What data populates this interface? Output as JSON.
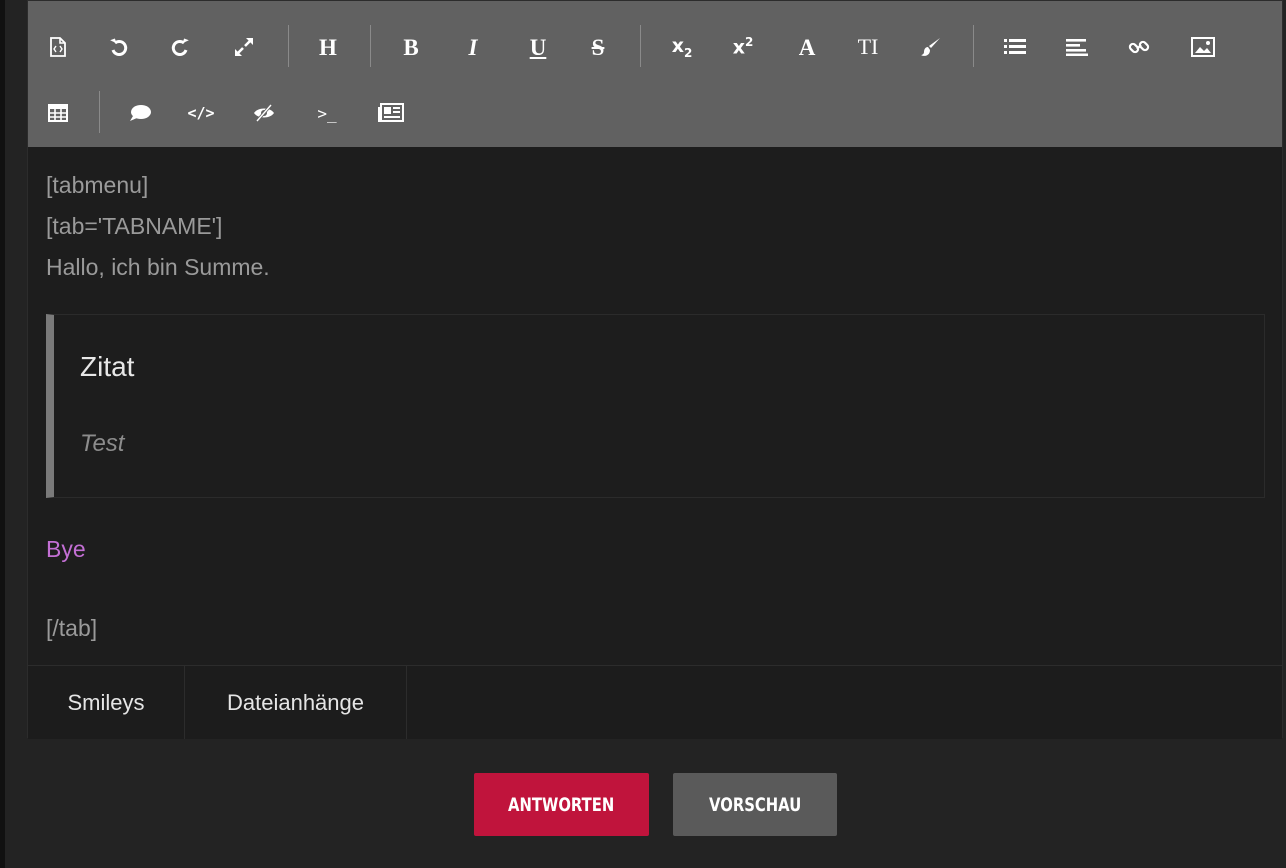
{
  "colors": {
    "toolbar_bg": "#616161",
    "editor_bg": "#1d1d1d",
    "text_gray": "#9a9a9a",
    "bye_text": "#c36fd4",
    "reply_button": "#c0143c",
    "preview_button": "#5a5a5a"
  },
  "toolbar": {
    "row1": [
      {
        "icon": "source-code-icon"
      },
      {
        "icon": "undo-icon"
      },
      {
        "icon": "redo-icon"
      },
      {
        "icon": "fullscreen-icon"
      },
      {
        "icon": "heading-icon",
        "label": "H"
      },
      {
        "icon": "bold-icon",
        "label": "B"
      },
      {
        "icon": "italic-icon",
        "label": "I"
      },
      {
        "icon": "underline-icon",
        "label": "U"
      },
      {
        "icon": "strikethrough-icon",
        "label": "S"
      },
      {
        "icon": "subscript-icon",
        "label": "x",
        "sub": "2"
      },
      {
        "icon": "superscript-icon",
        "label": "x",
        "sup": "2"
      },
      {
        "icon": "font-icon",
        "label": "A"
      },
      {
        "icon": "font-size-icon",
        "label": "TI"
      },
      {
        "icon": "brush-icon"
      },
      {
        "icon": "list-icon"
      },
      {
        "icon": "align-icon"
      },
      {
        "icon": "link-icon"
      },
      {
        "icon": "image-icon"
      }
    ],
    "row2": [
      {
        "icon": "table-icon"
      },
      {
        "icon": "quote-bubble-icon"
      },
      {
        "icon": "code-icon",
        "label": "</>"
      },
      {
        "icon": "spoiler-icon"
      },
      {
        "icon": "terminal-icon",
        "label": ">_"
      },
      {
        "icon": "media-icon"
      }
    ]
  },
  "content": {
    "line1": "[tabmenu]",
    "line2": "[tab='TABNAME']",
    "line3": "Hallo, ich bin Summe.",
    "quote_title": "Zitat",
    "quote_body": "Test",
    "bye": "Bye",
    "closing": "[/tab]"
  },
  "tabs": {
    "smileys": "Smileys",
    "attachments": "Dateianhänge"
  },
  "buttons": {
    "reply": "ANTWORTEN",
    "preview": "VORSCHAU"
  }
}
